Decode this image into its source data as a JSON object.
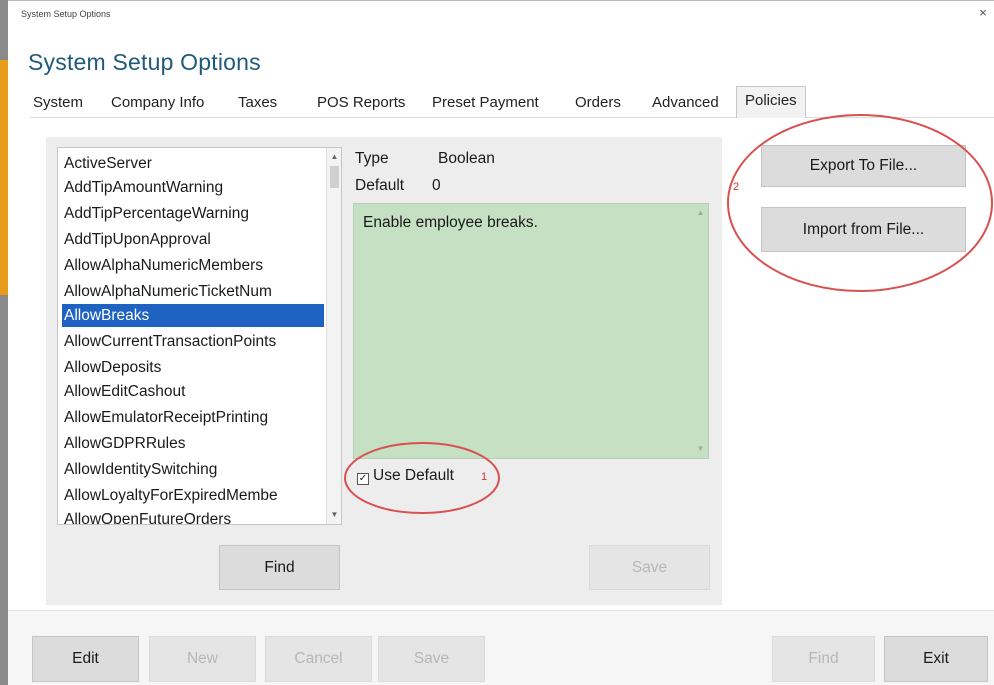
{
  "window": {
    "titlebar_text": "System Setup Options",
    "close_glyph": "×"
  },
  "app_title": "System Setup Options",
  "tabs": [
    {
      "label": "System",
      "active": false
    },
    {
      "label": "Company Info",
      "active": false
    },
    {
      "label": "Taxes",
      "active": false
    },
    {
      "label": "POS Reports",
      "active": false
    },
    {
      "label": "Preset Payment",
      "active": false
    },
    {
      "label": "Orders",
      "active": false
    },
    {
      "label": "Advanced",
      "active": false
    },
    {
      "label": "Policies",
      "active": true
    }
  ],
  "policy_list": {
    "items": [
      "ActiveServer",
      "AddTipAmountWarning",
      "AddTipPercentageWarning",
      "AddTipUponApproval",
      "AllowAlphaNumericMembers",
      "AllowAlphaNumericTicketNum",
      "AllowBreaks",
      "AllowCurrentTransactionPoints",
      "AllowDeposits",
      "AllowEditCashout",
      "AllowEmulatorReceiptPrinting",
      "AllowGDPRRules",
      "AllowIdentitySwitching",
      "AllowLoyaltyForExpiredMembe",
      "AllowOpenFutureOrders"
    ],
    "selected": "AllowBreaks"
  },
  "policy_detail": {
    "type_label": "Type",
    "type_value": "Boolean",
    "default_label": "Default",
    "default_value": "0",
    "description": "Enable employee breaks.",
    "use_default_label": "Use Default",
    "use_default_checked": true,
    "check_glyph": "✓"
  },
  "buttons": {
    "export_label": "Export To File...",
    "import_label": "Import from File...",
    "find_label": "Find",
    "save_label": "Save"
  },
  "bottom_bar": {
    "edit_label": "Edit",
    "new_label": "New",
    "cancel_label": "Cancel",
    "save_label": "Save",
    "find_label": "Find",
    "exit_label": "Exit"
  },
  "annotations": {
    "marker_1": "1",
    "marker_2": "2",
    "color": "#d23434"
  },
  "colors": {
    "title_blue": "#1f5a7a",
    "selection_blue": "#1e63c2",
    "description_green": "#c5e0c3",
    "accent_orange": "#e79d1a"
  }
}
